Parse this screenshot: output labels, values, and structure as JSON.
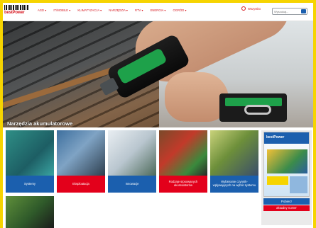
{
  "header": {
    "logo_text": "bestPower",
    "logo_subtext": "",
    "nav": [
      {
        "label": "AGD ▾"
      },
      {
        "label": "IT/MOBILE ▾"
      },
      {
        "label": "KLIMATYZACJA ▾"
      },
      {
        "label": "NARZĘDZIA ▾"
      },
      {
        "label": "RTV ▾"
      },
      {
        "label": "ENERGIA ▾"
      },
      {
        "label": "OGRÓD ▾"
      }
    ],
    "shop_label": "Wszystko",
    "search_placeholder": "Wyszukaj..."
  },
  "hero": {
    "title": "Narzędzia akumulatorowe"
  },
  "tiles": [
    {
      "label": "Systemy",
      "color": "blue"
    },
    {
      "label": "Eksploatacja",
      "color": "red"
    },
    {
      "label": "Innowacje",
      "color": "blue"
    },
    {
      "label": "Rodzaje stosowanych akumulatorów",
      "color": "red"
    },
    {
      "label": "Wybieranie czynnik-wpływających na wybór systemu",
      "color": "blue"
    },
    {
      "label": "",
      "color": "none"
    }
  ],
  "catalog": {
    "brand": "bestPower",
    "download_label": "Pobierz",
    "issue_label": "aktualny numer"
  },
  "colors": {
    "accent_red": "#e3001b",
    "accent_blue": "#1b5fae",
    "frame_yellow": "#f6d400"
  }
}
